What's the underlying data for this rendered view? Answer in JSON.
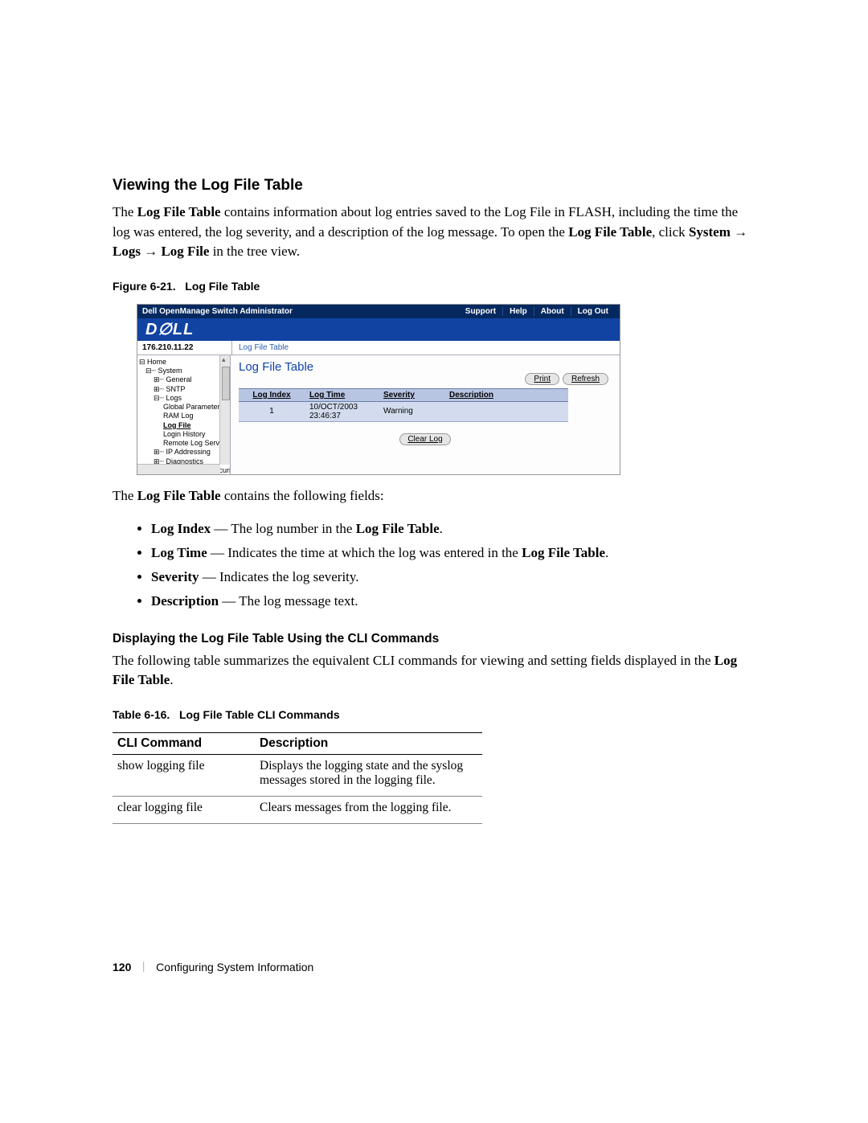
{
  "heading": "Viewing the Log File Table",
  "intro_parts": {
    "p1": "The ",
    "b1": "Log File Table",
    "p2": " contains information about log entries saved to the Log File in FLASH, including the time the log was entered, the log severity, and a description of the log message. To open the ",
    "b2": "Log File Table",
    "p3": ", click ",
    "b3": "System",
    "arrow1": " → ",
    "b4": "Logs",
    "arrow2": " → ",
    "b5": "Log File",
    "p4": " in the tree view."
  },
  "figure_caption_label": "Figure 6-21.",
  "figure_caption_title": "Log File Table",
  "screenshot": {
    "titlebar": "Dell OpenManage Switch Administrator",
    "links": [
      "Support",
      "Help",
      "About",
      "Log Out"
    ],
    "logo": "D∅LL",
    "ip": "176.210.11.22",
    "crumb": "Log File Table",
    "tree": {
      "home": "Home",
      "system": "System",
      "general": "General",
      "sntp": "SNTP",
      "logs": "Logs",
      "global": "Global Parameter",
      "ram": "RAM Log",
      "logfile": "Log File",
      "login": "Login History",
      "remote": "Remote Log Serv",
      "ip_addr": "IP Addressing",
      "diag": "Diagnostics",
      "mgmt": "Management Securit"
    },
    "panel_title": "Log File Table",
    "buttons": {
      "print": "Print",
      "refresh": "Refresh",
      "clear": "Clear Log"
    },
    "table_headers": [
      "Log Index",
      "Log Time",
      "Severity",
      "Description"
    ],
    "row": {
      "index": "1",
      "time_line1": "10/OCT/2003",
      "time_line2": "23:46:37",
      "severity": "Warning",
      "description": ""
    }
  },
  "fields_intro": {
    "p1": "The ",
    "b1": "Log File Table",
    "p2": " contains the following fields:"
  },
  "fields": [
    {
      "name": "Log Index",
      "desc": " — The log number in the ",
      "bold2": "Log File Table",
      "tail": "."
    },
    {
      "name": "Log Time",
      "desc": " — Indicates the time at which the log was entered in the ",
      "bold2": "Log File Table",
      "tail": "."
    },
    {
      "name": "Severity",
      "desc": " — Indicates the log severity.",
      "bold2": "",
      "tail": ""
    },
    {
      "name": "Description",
      "desc": " — The log message text.",
      "bold2": "",
      "tail": ""
    }
  ],
  "cli_heading": "Displaying the Log File Table Using the CLI Commands",
  "cli_intro": {
    "p1": "The following table summarizes the equivalent CLI commands for viewing and setting fields displayed in the ",
    "b1": "Log File Table",
    "p2": "."
  },
  "table_caption_label": "Table 6-16.",
  "table_caption_title": "Log File Table CLI Commands",
  "cli_table": {
    "headers": [
      "CLI Command",
      "Description"
    ],
    "rows": [
      {
        "cmd": "show logging file",
        "desc": "Displays the logging state and the syslog messages stored in the logging file."
      },
      {
        "cmd": "clear logging file",
        "desc": "Clears messages from the logging file."
      }
    ]
  },
  "footer": {
    "page": "120",
    "sep": "|",
    "section": "Configuring System Information"
  }
}
